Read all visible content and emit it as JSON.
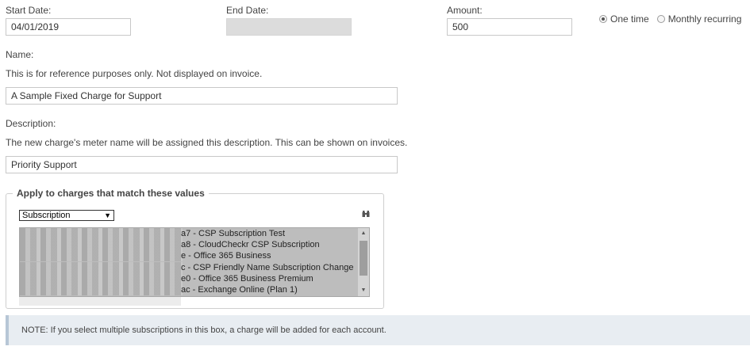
{
  "form": {
    "start_date": {
      "label": "Start Date:",
      "value": "04/01/2019"
    },
    "end_date": {
      "label": "End Date:",
      "value": ""
    },
    "amount": {
      "label": "Amount:",
      "value": "500"
    },
    "frequency": {
      "options": [
        {
          "label": "One time",
          "checked": true
        },
        {
          "label": "Monthly recurring",
          "checked": false
        }
      ]
    },
    "name": {
      "label": "Name:",
      "help": "This is for reference purposes only. Not displayed on invoice.",
      "value": "A Sample Fixed Charge for Support"
    },
    "description": {
      "label": "Description:",
      "help": "The new charge's meter name will be assigned this description. This can be shown on invoices.",
      "value": "Priority Support"
    }
  },
  "filter_group": {
    "legend": "Apply to charges that match these values",
    "select_value": "Subscription",
    "icon": "binoculars-icon",
    "items": [
      "a7 - CSP Subscription Test",
      "a8 - CloudCheckr CSP Subscription",
      "e - Office 365 Business",
      "c - CSP Friendly Name Subscription Change",
      "e0 - Office 365 Business Premium",
      "ac - Exchange Online (Plan 1)"
    ]
  },
  "note": {
    "text": "NOTE: If you select multiple subscriptions in this box, a charge will be added for each account."
  }
}
